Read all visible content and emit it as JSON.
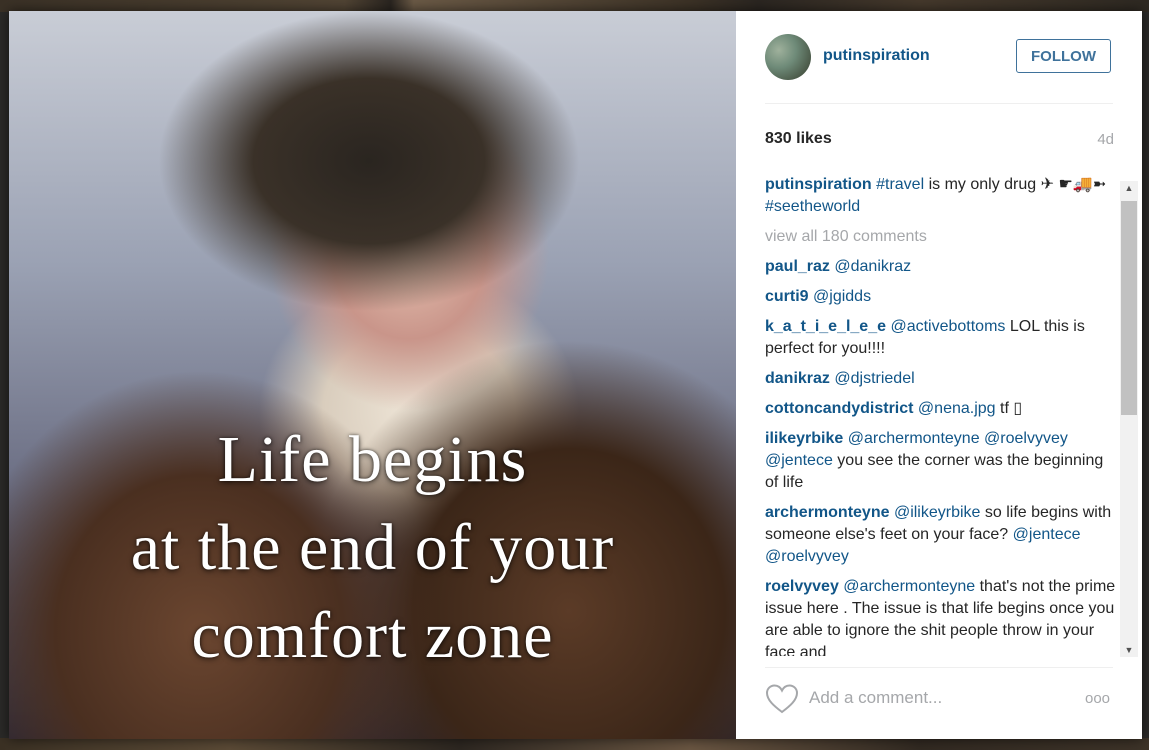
{
  "post": {
    "image_caption_lines": [
      "Life begins",
      "at the end of your",
      "comfort zone"
    ]
  },
  "header": {
    "username": "putinspiration",
    "follow_label": "FOLLOW"
  },
  "stats": {
    "likes": "830 likes",
    "time_ago": "4d"
  },
  "caption": {
    "author": "putinspiration",
    "hashtag1": "#travel",
    "text": " is my only drug ✈ ",
    "emojis": "☛🚚➼ ",
    "hashtag2": "#seetheworld"
  },
  "view_all": "view all 180 comments",
  "comments": [
    {
      "author": "paul_raz",
      "mention": "@danikraz",
      "text": ""
    },
    {
      "author": "curti9",
      "mention": "@jgidds",
      "text": ""
    },
    {
      "author": "k_a_t_i_e_l_e_e",
      "mention": "@activebottoms",
      "text": " LOL this is perfect for you!!!!"
    },
    {
      "author": "danikraz",
      "mention": "@djstriedel",
      "text": ""
    },
    {
      "author": "cottoncandydistrict",
      "mention": "@nena.jpg",
      "text": " tf ▯"
    },
    {
      "author": "ilikeyrbike",
      "mention": "@archermonteyne @roelvyvey @jentece",
      "text": " you see the corner was the beginning of life"
    },
    {
      "author": "archermonteyne",
      "mention": "@ilikeyrbike",
      "text": " so life begins with someone else's feet on your face? ",
      "mention2": "@jentece @roelvyvey"
    },
    {
      "author": "roelvyvey",
      "mention": "@archermonteyne",
      "text": " that's not the prime issue here . The issue is that life begins once you are able to ignore the shit people throw in your face and"
    }
  ],
  "comment_box": {
    "placeholder": "Add a comment...",
    "heart_icon": "heart-outline-icon",
    "more_icon": "ellipsis-icon",
    "more_glyph": "ooo"
  },
  "colors": {
    "link": "#125688",
    "follow": "#3f729b",
    "muted": "#a5a7aa"
  }
}
